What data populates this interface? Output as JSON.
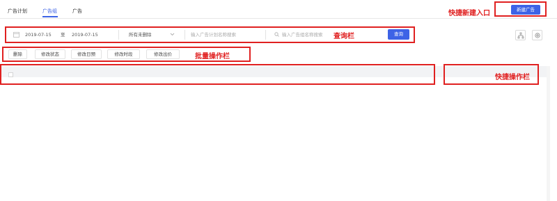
{
  "tabs": [
    {
      "label": "广告计划",
      "active": false
    },
    {
      "label": "广告组",
      "active": true
    },
    {
      "label": "广告",
      "active": false
    }
  ],
  "quick_create": {
    "annotation": "快捷新建入口",
    "button_label": "新建广告"
  },
  "query_bar": {
    "annotation": "查询栏",
    "calendar_icon": "calendar-icon",
    "date_start": "2019-07-15",
    "date_to": "至",
    "date_end": "2019-07-15",
    "status_select": "所有未删除",
    "plan_placeholder": "输入广告计划名称搜索",
    "group_placeholder": "输入广告组名称搜索",
    "search_button": "查询"
  },
  "tools": {
    "columns_icon": "sitemap-icon",
    "settings_icon": "gear-icon"
  },
  "batch_bar": {
    "annotation": "批量操作栏",
    "buttons": [
      "删除",
      "修改状态",
      "修改日预",
      "修改时段",
      "修改出价"
    ]
  },
  "table": {
    "quick_annotation": "快捷操作栏"
  },
  "colors": {
    "accent": "#3d63e6",
    "annotation_red": "#e02020",
    "header_bg": "#f2f3f5"
  }
}
